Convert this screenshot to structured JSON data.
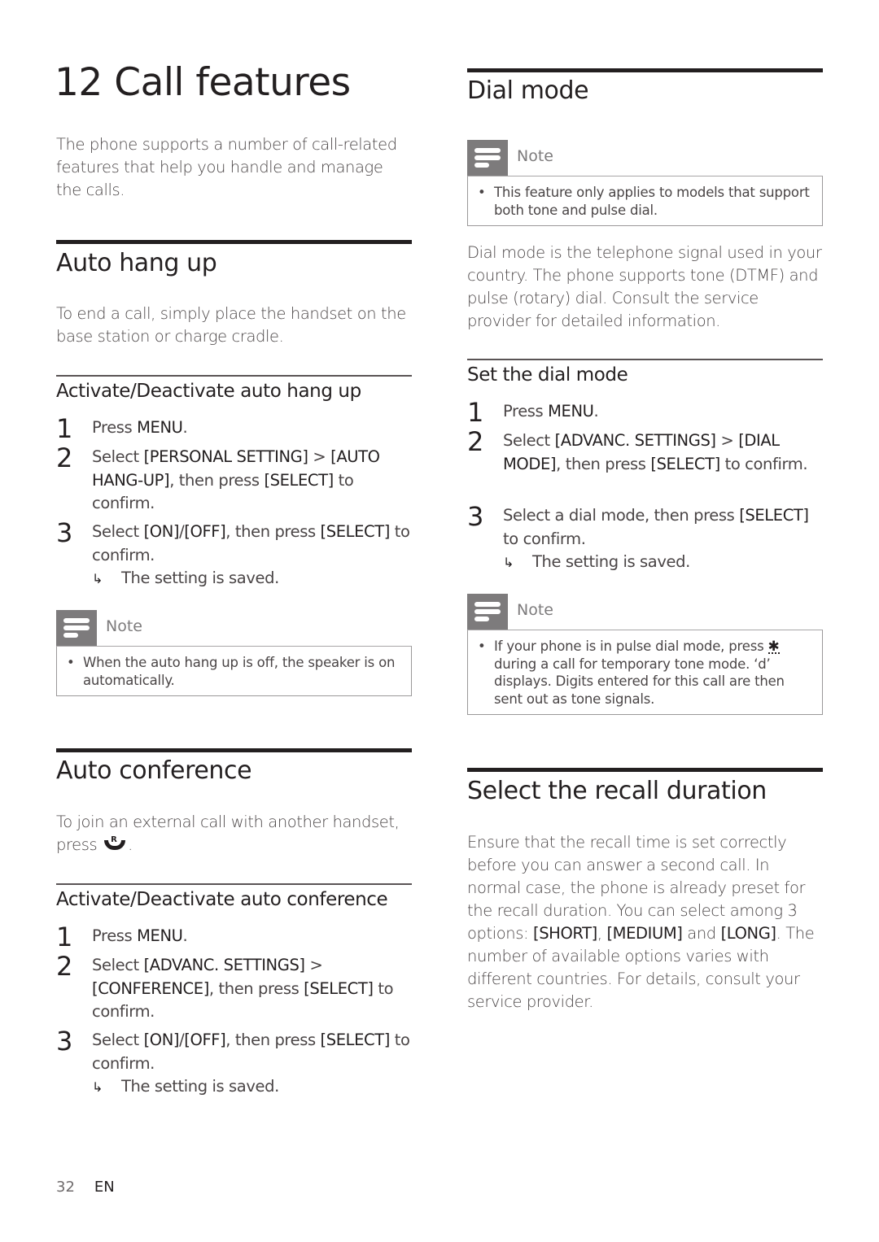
{
  "chapter": {
    "title": "12 Call features",
    "intro": "The phone supports a number of call-related features that help you handle and manage the calls."
  },
  "auto_hang_up": {
    "title": "Auto hang up",
    "body": "To end a call, simply place the handset on the base station or charge cradle.",
    "subsection": {
      "title": "Activate/Deactivate auto hang up",
      "steps": [
        {
          "num": "1",
          "text_html": "Press <b>MENU</b>."
        },
        {
          "num": "2",
          "text_html": "Select <b>[PERSONAL SETTING]</b> &gt; <b>[AUTO HANG-UP]</b>, then press <b>[SELECT]</b> to confirm."
        },
        {
          "num": "3",
          "text_html": "Select <b>[ON]</b>/<b>[OFF]</b>, then press <b>[SELECT]</b> to confirm."
        }
      ],
      "result": "The setting is saved."
    },
    "note": {
      "label": "Note",
      "items": [
        "When the auto hang up is off, the speaker is on automatically."
      ]
    }
  },
  "auto_conference": {
    "title": "Auto conference",
    "body_before_icon": "To join an external call with another handset, press",
    "body_after_icon": ".",
    "recall_icon_label": "R",
    "subsection": {
      "title": "Activate/Deactivate auto conference",
      "steps": [
        {
          "num": "1",
          "text_html": "Press <b>MENU</b>."
        },
        {
          "num": "2",
          "text_html": "Select <b>[ADVANC. SETTINGS]</b> &gt; <b>[CONFERENCE]</b>, then press <b>[SELECT]</b> to confirm."
        },
        {
          "num": "3",
          "text_html": "Select <b>[ON]</b>/<b>[OFF]</b>, then press <b>[SELECT]</b> to confirm."
        }
      ],
      "result": "The setting is saved."
    }
  },
  "dial_mode": {
    "title": "Dial mode",
    "note_top": {
      "label": "Note",
      "items": [
        "This feature only applies to models that support both tone and pulse dial."
      ]
    },
    "body": "Dial mode is the telephone signal used in your country. The phone supports tone (DTMF) and pulse (rotary) dial. Consult the service provider for detailed information.",
    "subsection": {
      "title": "Set the dial mode",
      "steps": [
        {
          "num": "1",
          "text_html": "Press <b>MENU</b>."
        },
        {
          "num": "2",
          "text_html": "Select <b>[ADVANC. SETTINGS]</b> &gt; <b>[DIAL MODE]</b>, then press <b>[SELECT]</b> to confirm."
        },
        {
          "num": "3",
          "text_html": "Select a dial mode, then press <b>[SELECT]</b> to confirm."
        }
      ],
      "result": "The setting is saved."
    },
    "note_bottom": {
      "label": "Note",
      "item_before_icon": "If your phone is in pulse dial mode, press",
      "star_icon": "✱",
      "item_after_icon": "during a call for temporary tone mode. ‘d’ displays. Digits entered for this call are then sent out as tone signals."
    }
  },
  "recall_duration": {
    "title": "Select the recall duration",
    "body_html": "Ensure that the recall time is set correctly before you can answer a second call. In normal case, the phone is already preset for the recall duration. You can select among 3 options: <b>[SHORT]</b>, <b>[MEDIUM]</b> and <b>[LONG]</b>. The number of available options varies with different countries. For details, consult your service provider."
  },
  "footer": {
    "page_number": "32",
    "language": "EN"
  },
  "icons": {
    "bullet": "•",
    "result_arrow": "↳"
  }
}
